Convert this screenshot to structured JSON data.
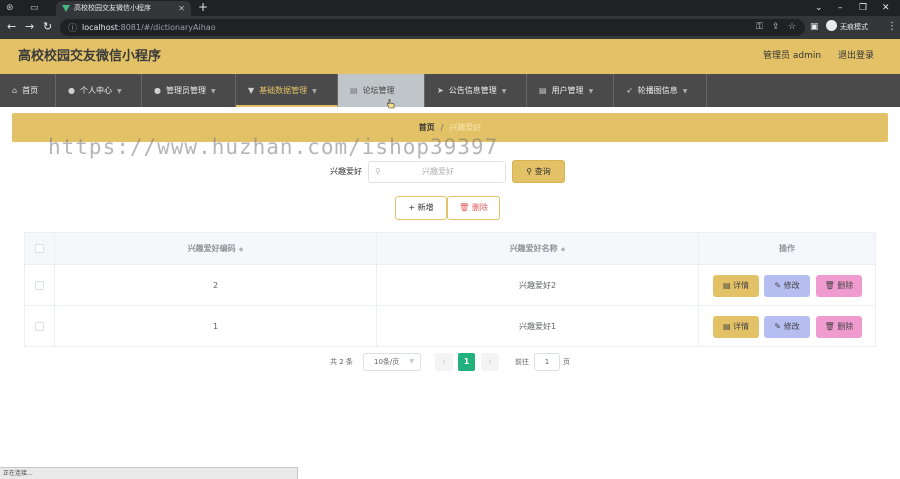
{
  "browser": {
    "tab_title": "高校校园交友微信小程序",
    "url_host": "localhost",
    "url_path": ":8081/#/dictionaryAihao",
    "profile_label": "无痕模式",
    "status_text": "正在连接..."
  },
  "header": {
    "title": "高校校园交友微信小程序",
    "user": "管理员 admin",
    "logout": "退出登录"
  },
  "nav": {
    "items": [
      {
        "label": "首页",
        "icon": "home-icon"
      },
      {
        "label": "个人中心",
        "icon": "user-icon"
      },
      {
        "label": "管理员管理",
        "icon": "admin-icon"
      },
      {
        "label": "基础数据管理",
        "icon": "data-icon"
      },
      {
        "label": "论坛管理",
        "icon": "forum-icon"
      },
      {
        "label": "公告信息管理",
        "icon": "notice-icon"
      },
      {
        "label": "用户管理",
        "icon": "users-icon"
      },
      {
        "label": "轮播图信息",
        "icon": "carousel-icon"
      }
    ]
  },
  "breadcrumb": {
    "home": "首页",
    "separator": "/",
    "current": "兴趣爱好"
  },
  "search": {
    "label": "兴趣爱好",
    "placeholder": "兴趣爱好",
    "button": "查询"
  },
  "actions": {
    "add": "新增",
    "delete": "删除"
  },
  "table": {
    "columns": [
      "兴趣爱好编码",
      "兴趣爱好名称",
      "操作"
    ],
    "rows": [
      {
        "code": "2",
        "name": "兴趣爱好2"
      },
      {
        "code": "1",
        "name": "兴趣爱好1"
      }
    ],
    "row_actions": {
      "detail": "详情",
      "edit": "修改",
      "remove": "删除"
    }
  },
  "pagination": {
    "total": "共 2 条",
    "page_size": "10条/页",
    "current_page": "1",
    "goto_label": "前往",
    "goto_value": "1",
    "page_suffix": "页"
  },
  "watermark": "https://www.huzhan.com/ishop39397",
  "colors": {
    "primary": "#e3c267",
    "nav_bg": "#4a4a4a",
    "edit_btn": "#b6bdf0",
    "remove_btn": "#f09bd0",
    "page_active": "#22b07d"
  }
}
